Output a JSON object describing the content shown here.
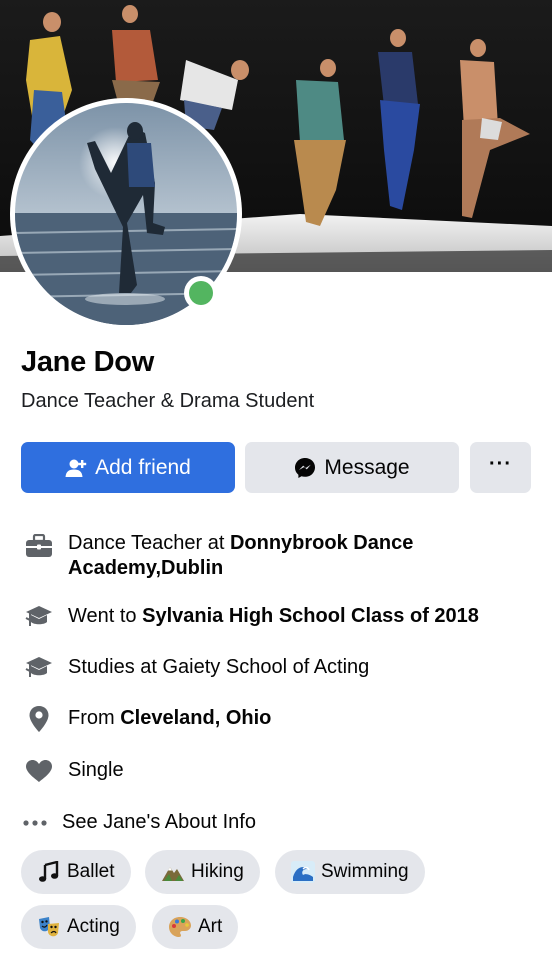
{
  "profile": {
    "name": "Jane Dow",
    "tagline": "Dance Teacher & Drama Student"
  },
  "actions": {
    "add_friend": "Add friend",
    "message": "Message",
    "more": "···"
  },
  "about": {
    "work_prefix": "Dance Teacher at ",
    "work_place": "Donnybrook Dance Academy,Dublin",
    "school_prefix": "Went to ",
    "school_place": "Sylvania High School Class of 2018",
    "studies": "Studies at Gaiety School of Acting",
    "from_prefix": "From ",
    "from_place": "Cleveland, Ohio",
    "relationship": "Single",
    "see_more": "See Jane's About Info"
  },
  "interests": [
    "Ballet",
    "Hiking",
    "Swimming",
    "Acting",
    "Art"
  ],
  "colors": {
    "primary_button": "#2f6fdf",
    "secondary_button": "#e4e6eb",
    "online_status": "#53b560",
    "icon_gray": "#5f6368"
  },
  "icons": {
    "work": "briefcase-icon",
    "education": "graduation-cap-icon",
    "location": "location-pin-icon",
    "relationship": "heart-icon",
    "more": "more-dots-icon"
  }
}
